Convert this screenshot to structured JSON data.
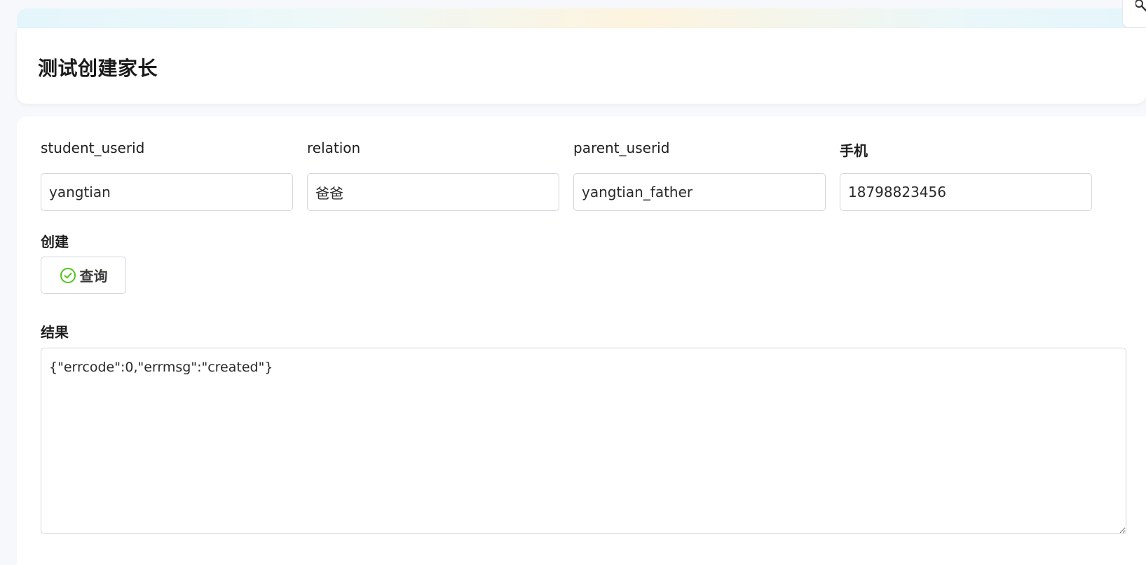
{
  "header": {
    "title": "测试创建家长"
  },
  "form": {
    "fields": [
      {
        "label": "student_userid",
        "value": "yangtian"
      },
      {
        "label": "relation",
        "value": "爸爸"
      },
      {
        "label": "parent_userid",
        "value": "yangtian_father"
      },
      {
        "label": "手机",
        "value": "18798823456"
      }
    ],
    "action_label": "创建",
    "submit_label": "查询",
    "result_label": "结果",
    "result_value": "{\"errcode\":0,\"errmsg\":\"created\"}"
  },
  "icons": {
    "submit_icon": "check-circle-icon",
    "corner_icon": "search-icon"
  },
  "colors": {
    "success_green": "#52c41a"
  }
}
